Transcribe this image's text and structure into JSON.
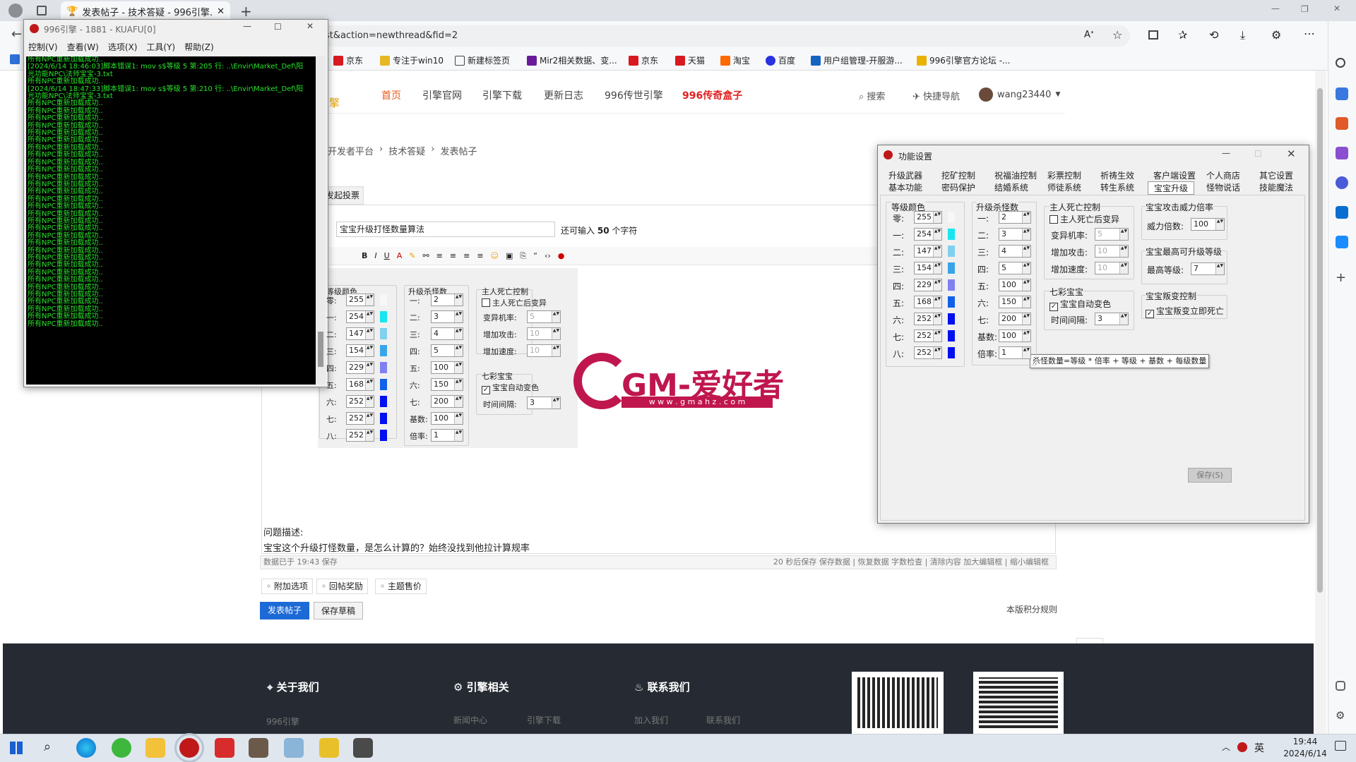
{
  "browser": {
    "tab_title": "发表帖子 - 技术答疑 - 996引擎...",
    "address": "st&action=newthread&fid=2",
    "favorites": [
      "京东",
      "专注于win10",
      "新建标签页",
      "Mir2相关数据、变...",
      "京东",
      "天猫",
      "淘宝",
      "百度",
      "用户组管理-开服游...",
      "996引擎官方论坛 -..."
    ]
  },
  "site": {
    "nav": [
      "首页",
      "引擎官网",
      "引擎下载",
      "更新日志",
      "996传世引擎",
      "996传奇盒子"
    ],
    "search": "搜索",
    "quick_nav": "快捷导航",
    "user": "wang23440",
    "breadcrumb": [
      "开发者平台",
      "技术答疑",
      "发表帖子"
    ],
    "poll_tab": "发起投票",
    "subject": "宝宝升级打怪数量算法",
    "subject_hint": "还可输入",
    "subject_count": "50",
    "subject_unit": "个字符",
    "desc_label": "问题描述:",
    "desc_text": "宝宝这个升级打怪数量，是怎么计算的？始终没找到他拉计算规率",
    "status_left": "数据已于 19:43 保存",
    "status_right": "20 秒后保存 保存数据 | 恢复数据    字数检查 | 清除内容    加大编辑框 | 缩小编辑框",
    "options": [
      "附加选项",
      "回帖奖励",
      "主题售价"
    ],
    "post_button": "发表帖子",
    "draft_button": "保存草稿",
    "rules": "本版积分规则",
    "watermark": "GM-爱好者",
    "watermark_url": "w w w . g m a h z . c o m",
    "footer": {
      "about": "关于我们",
      "engine": "引擎相关",
      "contact": "联系我们",
      "engine_name": "996引擎",
      "news": "新闻中心",
      "download": "引擎下载",
      "join": "加入我们",
      "contact_us": "联系我们"
    }
  },
  "console": {
    "title": "996引擎 - 1881 - KUAFU[0]",
    "menu": [
      "控制(V)",
      "查看(W)",
      "选项(X)",
      "工具(Y)",
      "帮助(Z)"
    ],
    "lines": [
      "所有NPC重新加载成功..",
      "[2024/6/14 18:46:03]脚本错误1: mov s$等级 5 第:205 行: ..\\Envir\\Market_Def\\阳",
      "光功能NPC\\法师宝宝-3.txt",
      "所有NPC重新加载成功..",
      "[2024/6/14 18:47:33]脚本错误1: mov s$等级 5 第:210 行: ..\\Envir\\Market_Def\\阳",
      "光功能NPC\\法师宝宝-3.txt",
      "所有NPC重新加载成功..",
      "所有NPC重新加载成功..",
      "所有NPC重新加载成功..",
      "所有NPC重新加载成功..",
      "所有NPC重新加载成功..",
      "所有NPC重新加载成功..",
      "所有NPC重新加载成功..",
      "所有NPC重新加载成功..",
      "所有NPC重新加载成功..",
      "所有NPC重新加载成功..",
      "所有NPC重新加载成功..",
      "所有NPC重新加载成功..",
      "所有NPC重新加载成功..",
      "所有NPC重新加载成功..",
      "所有NPC重新加载成功..",
      "所有NPC重新加载成功..",
      "所有NPC重新加载成功..",
      "所有NPC重新加载成功..",
      "所有NPC重新加载成功..",
      "所有NPC重新加载成功..",
      "所有NPC重新加载成功..",
      "所有NPC重新加载成功..",
      "所有NPC重新加载成功..",
      "所有NPC重新加载成功..",
      "所有NPC重新加载成功..",
      "所有NPC重新加载成功..",
      "所有NPC重新加载成功..",
      "所有NPC重新加载成功..",
      "所有NPC重新加载成功..",
      "所有NPC重新加载成功..",
      "所有NPC重新加载成功.."
    ]
  },
  "dialog": {
    "title": "功能设置",
    "tabs_row1": [
      "升级武器",
      "挖矿控制",
      "祝福油控制",
      "彩票控制",
      "祈祷生效",
      "客户端设置",
      "个人商店",
      "其它设置"
    ],
    "tabs_row2": [
      "基本功能",
      "密码保护",
      "结婚系统",
      "师徒系统",
      "转生系统",
      "宝宝升级",
      "怪物说话",
      "技能魔法"
    ],
    "color_group": "等级颜色",
    "color_rows": [
      {
        "label": "零:",
        "value": "255",
        "color": "#f7f7f7"
      },
      {
        "label": "一:",
        "value": "254",
        "color": "#18e6f0"
      },
      {
        "label": "二:",
        "value": "147",
        "color": "#80d0ee"
      },
      {
        "label": "三:",
        "value": "154",
        "color": "#3aa4e8"
      },
      {
        "label": "四:",
        "value": "229",
        "color": "#8080f0"
      },
      {
        "label": "五:",
        "value": "168",
        "color": "#1060e8"
      },
      {
        "label": "六:",
        "value": "252",
        "color": "#0010f0"
      },
      {
        "label": "七:",
        "value": "252",
        "color": "#0010f0"
      },
      {
        "label": "八:",
        "value": "252",
        "color": "#0010f0"
      }
    ],
    "kill_group": "升级杀怪数",
    "kill_rows": [
      {
        "label": "一:",
        "value": "2"
      },
      {
        "label": "二:",
        "value": "3"
      },
      {
        "label": "三:",
        "value": "4"
      },
      {
        "label": "四:",
        "value": "5"
      },
      {
        "label": "五:",
        "value": "100"
      },
      {
        "label": "六:",
        "value": "150"
      },
      {
        "label": "七:",
        "value": "200"
      },
      {
        "label": "基数:",
        "value": "100"
      },
      {
        "label": "倍率:",
        "value": "1"
      }
    ],
    "death_group": "主人死亡控制",
    "death_check": "主人死亡后变异",
    "death_rows": [
      {
        "label": "变异机率:",
        "value": "5"
      },
      {
        "label": "增加攻击:",
        "value": "10"
      },
      {
        "label": "增加速度:",
        "value": "10"
      }
    ],
    "rainbow_group": "七彩宝宝",
    "rainbow_check": "宝宝自动变色",
    "rainbow_interval_label": "时间间隔:",
    "rainbow_interval": "3",
    "attack_group": "宝宝攻击威力倍率",
    "attack_label": "威力倍数:",
    "attack_value": "100",
    "maxlvl_group": "宝宝最高可升级等级",
    "maxlvl_label": "最高等级:",
    "maxlvl_value": "7",
    "betray_group": "宝宝叛变控制",
    "betray_check": "宝宝叛变立即死亡",
    "tooltip": "杀怪数量=等级 * 倍率 + 等级 + 基数 + 每级数量",
    "save": "保存(S)"
  },
  "taskbar": {
    "time": "19:44",
    "date": "2024/6/14",
    "ime": "英"
  }
}
